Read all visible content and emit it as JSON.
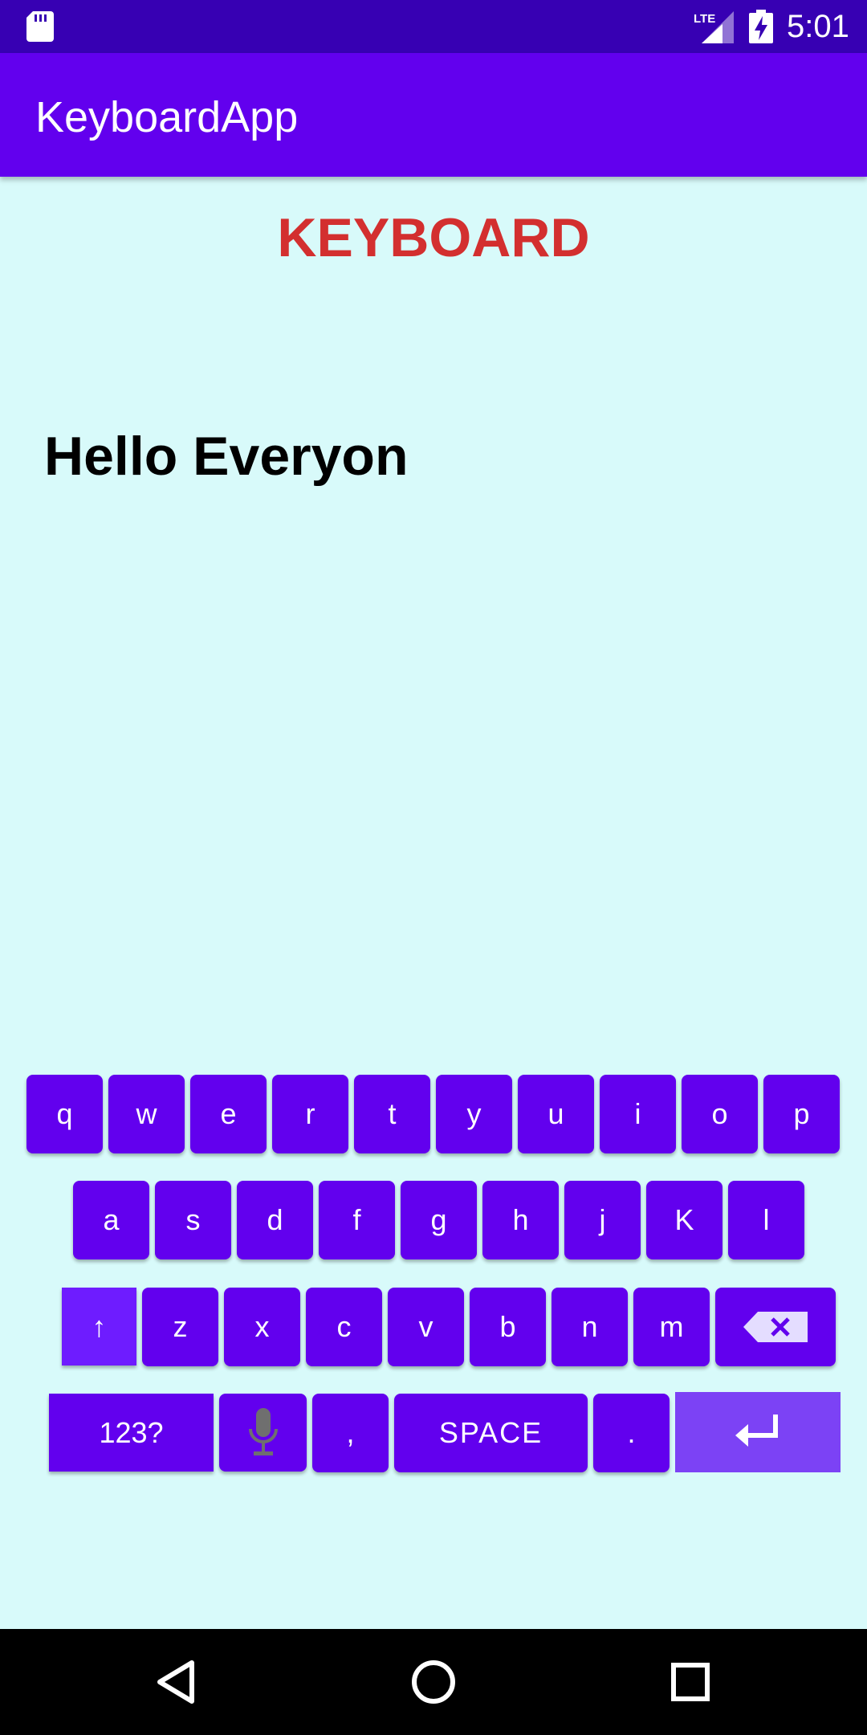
{
  "status_bar": {
    "time": "5:01",
    "network": "LTE",
    "icons": [
      "sd-card-icon",
      "lte-signal-icon",
      "battery-charging-icon"
    ]
  },
  "app_bar": {
    "title": "KeyboardApp"
  },
  "content": {
    "heading": "KEYBOARD",
    "typed_text": "Hello Everyon"
  },
  "keyboard": {
    "row1": [
      "q",
      "w",
      "e",
      "r",
      "t",
      "y",
      "u",
      "i",
      "o",
      "p"
    ],
    "row2": [
      "a",
      "s",
      "d",
      "f",
      "g",
      "h",
      "j",
      "K",
      "l"
    ],
    "row3": [
      "↑",
      "z",
      "x",
      "c",
      "v",
      "b",
      "n",
      "m"
    ],
    "symbols_label": "123?",
    "comma_label": ",",
    "space_label": "SPACE",
    "period_label": ".",
    "icons": [
      "shift-icon",
      "backspace-icon",
      "microphone-icon",
      "enter-icon"
    ]
  },
  "nav_bar": {
    "icons": [
      "back-icon",
      "home-icon",
      "recents-icon"
    ]
  },
  "colors": {
    "status_bar": "#3700b3",
    "app_bar": "#6200ee",
    "background": "#d8fafa",
    "heading": "#d32f2f",
    "key": "#6200ee",
    "enter_key": "#7c42f5"
  }
}
